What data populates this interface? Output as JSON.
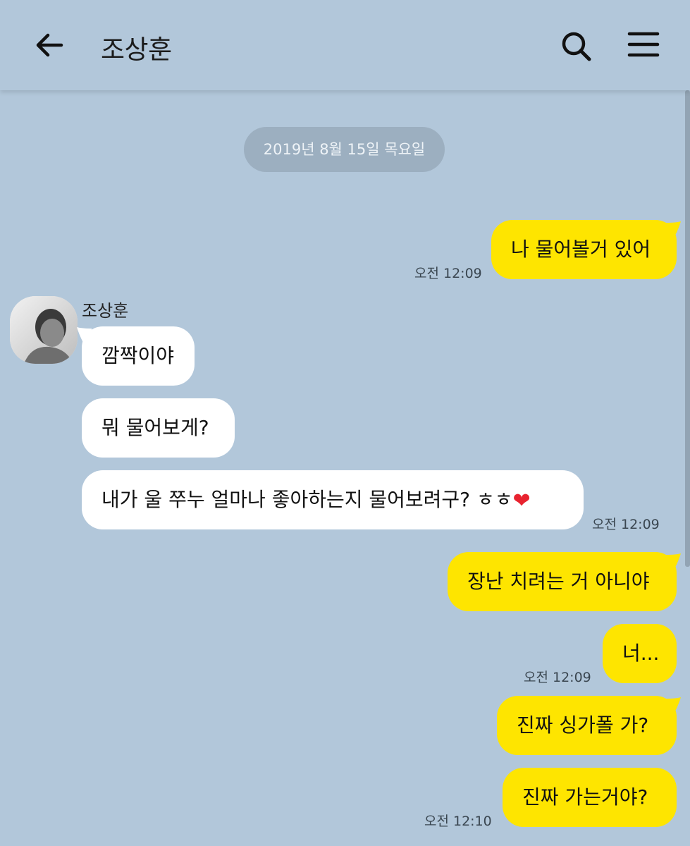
{
  "header": {
    "title": "조상훈",
    "back_icon": "arrow-left-icon",
    "search_icon": "search-icon",
    "menu_icon": "hamburger-menu-icon"
  },
  "date_divider": "2019년 8월 15일 목요일",
  "sender": {
    "name": "조상훈",
    "avatar_icon": "profile-photo"
  },
  "messages": [
    {
      "from": "me",
      "text": "나 물어볼거 있어",
      "time": "오전 12:09"
    },
    {
      "from": "them",
      "text": "깜짝이야",
      "time": ""
    },
    {
      "from": "them",
      "text": "뭐 물어보게?",
      "time": ""
    },
    {
      "from": "them",
      "text": "내가 울 쭈누 얼마나 좋아하는지 물어보려구?  ㅎㅎ",
      "emoji": "❤",
      "time": "오전 12:09"
    },
    {
      "from": "me",
      "text": "장난 치려는 거 아니야",
      "time": ""
    },
    {
      "from": "me",
      "text": "너...",
      "time": "오전 12:09"
    },
    {
      "from": "me",
      "text": "진짜 싱가폴 가?",
      "time": ""
    },
    {
      "from": "me",
      "text": "진짜 가는거야?",
      "time": "오전 12:10"
    }
  ],
  "colors": {
    "background": "#b2c7da",
    "my_bubble": "#fee500",
    "their_bubble": "#ffffff",
    "heart": "#e8232f"
  }
}
